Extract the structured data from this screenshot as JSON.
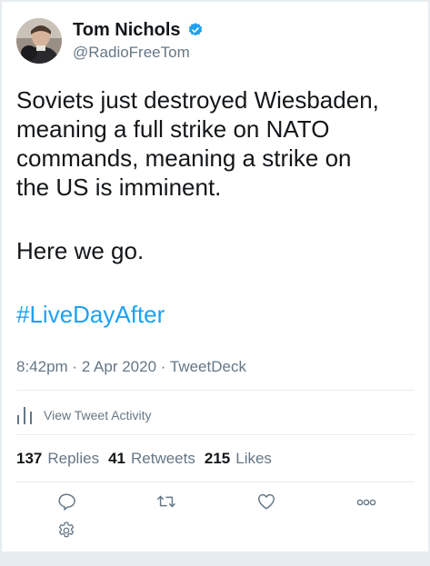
{
  "user": {
    "display_name": "Tom Nichols",
    "handle": "@RadioFreeTom",
    "verified": true
  },
  "tweet": {
    "line1": "Soviets just destroyed Wiesbaden,",
    "line2": "meaning a full strike on NATO",
    "line3": "commands, meaning a strike on",
    "line4": "the US is imminent.",
    "line5": "Here we go.",
    "hashtag": "#LiveDayAfter"
  },
  "meta": {
    "time": "8:42pm",
    "separator1": " · ",
    "date": "2 Apr 2020",
    "separator2": " · ",
    "source": "TweetDeck"
  },
  "activity": {
    "label": "View Tweet Activity",
    "icon": "bar-chart-icon"
  },
  "stats": {
    "replies_count": "137",
    "replies_label": "Replies",
    "retweets_count": "41",
    "retweets_label": "Retweets",
    "likes_count": "215",
    "likes_label": "Likes"
  },
  "actions": {
    "reply_icon": "reply-icon",
    "retweet_icon": "retweet-icon",
    "like_icon": "heart-icon",
    "more_icon": "more-icon",
    "settings_icon": "gear-icon"
  },
  "colors": {
    "accent": "#1da1f2",
    "text": "#14171a",
    "secondary": "#657786",
    "border": "#e6ecf0"
  }
}
